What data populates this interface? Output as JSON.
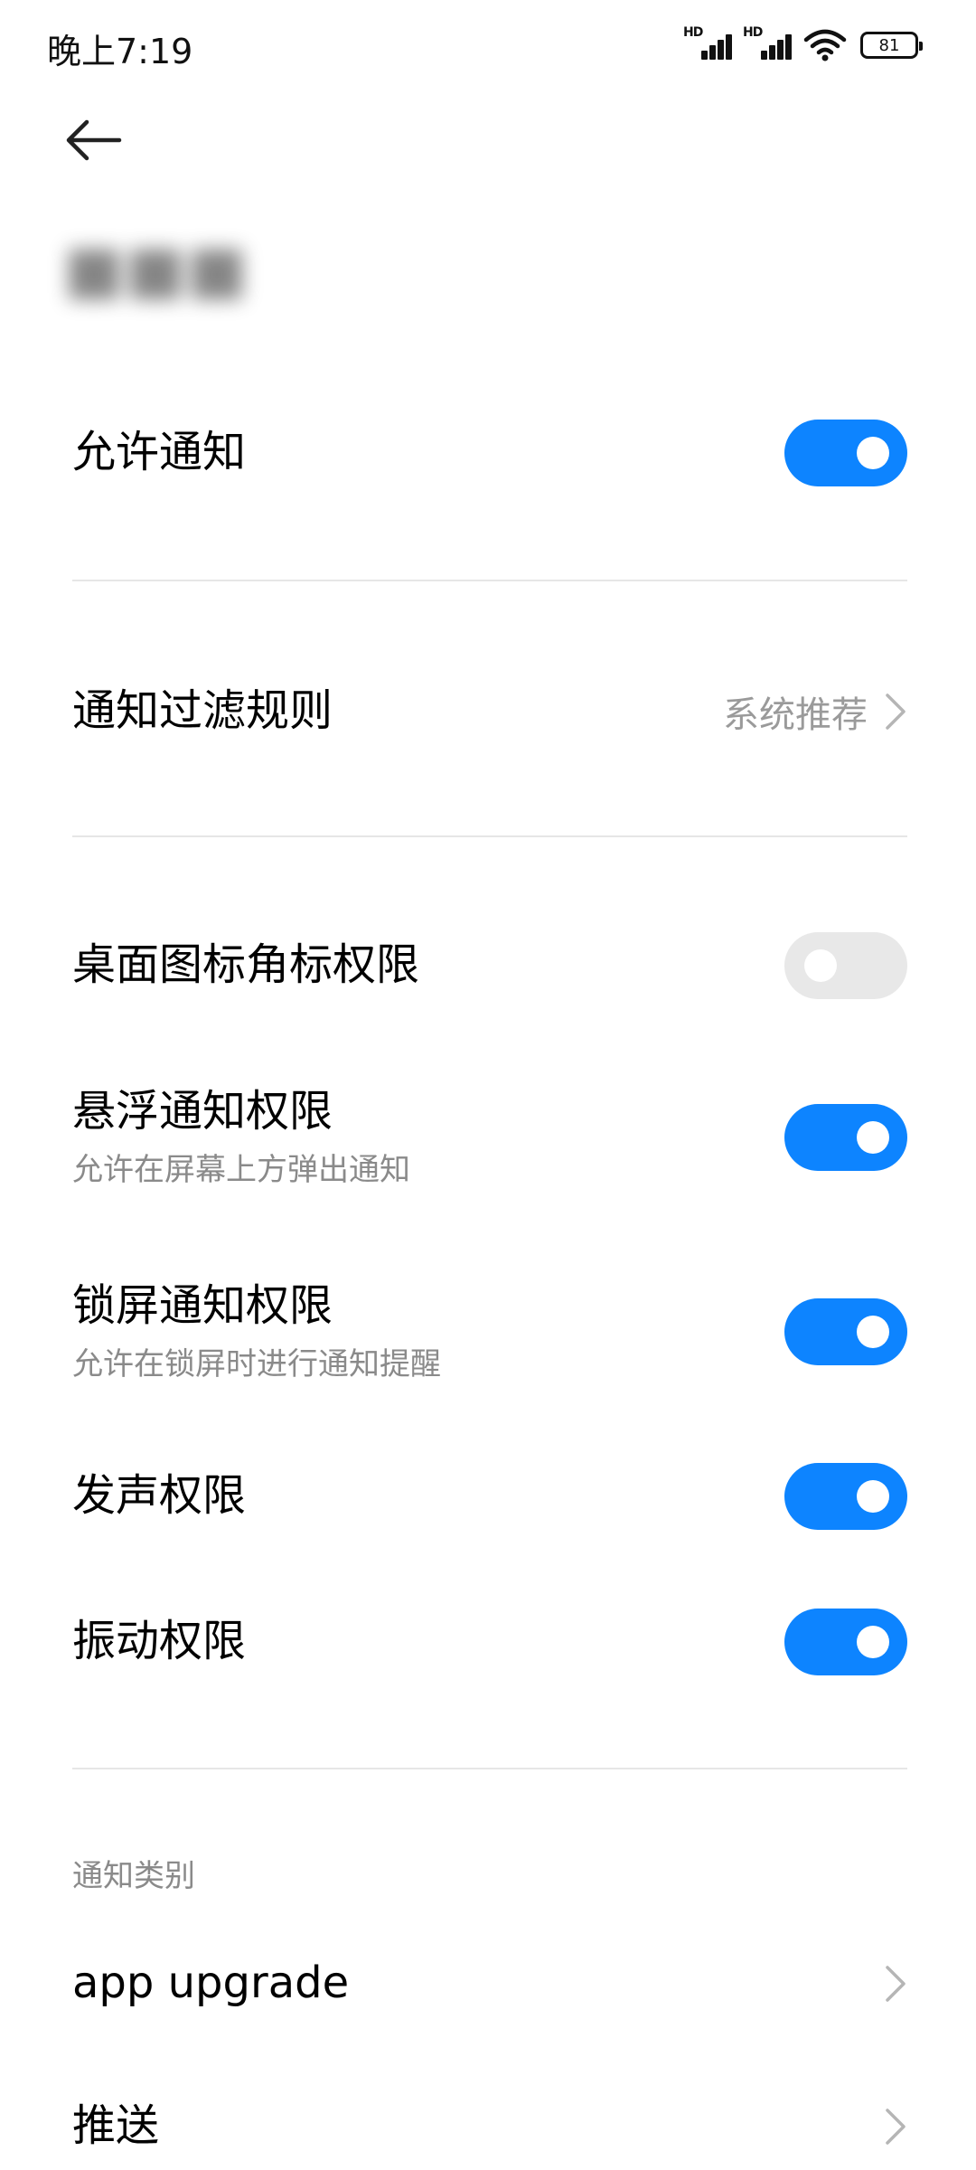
{
  "status_bar": {
    "time": "晚上7:19",
    "signal_1_label": "HD",
    "signal_2_label": "HD",
    "battery_level": "81"
  },
  "header": {
    "back_icon": "arrow-left-icon",
    "app_name": "■■■"
  },
  "settings": {
    "allow_notifications": {
      "label": "允许通知",
      "enabled": true
    },
    "filter_rules": {
      "label": "通知过滤规则",
      "value": "系统推荐"
    },
    "badge_permission": {
      "label": "桌面图标角标权限",
      "enabled": false
    },
    "floating_permission": {
      "label": "悬浮通知权限",
      "description": "允许在屏幕上方弹出通知",
      "enabled": true
    },
    "lockscreen_permission": {
      "label": "锁屏通知权限",
      "description": "允许在锁屏时进行通知提醒",
      "enabled": true
    },
    "sound_permission": {
      "label": "发声权限",
      "enabled": true
    },
    "vibration_permission": {
      "label": "振动权限",
      "enabled": true
    }
  },
  "categories": {
    "section_label": "通知类别",
    "items": [
      {
        "label": "app upgrade"
      },
      {
        "label": "推送"
      }
    ]
  },
  "colors": {
    "accent": "#0d84ff",
    "toggle_off": "#e8e8e8",
    "secondary_text": "#8a8a8a",
    "divider": "#e6e6e6"
  }
}
